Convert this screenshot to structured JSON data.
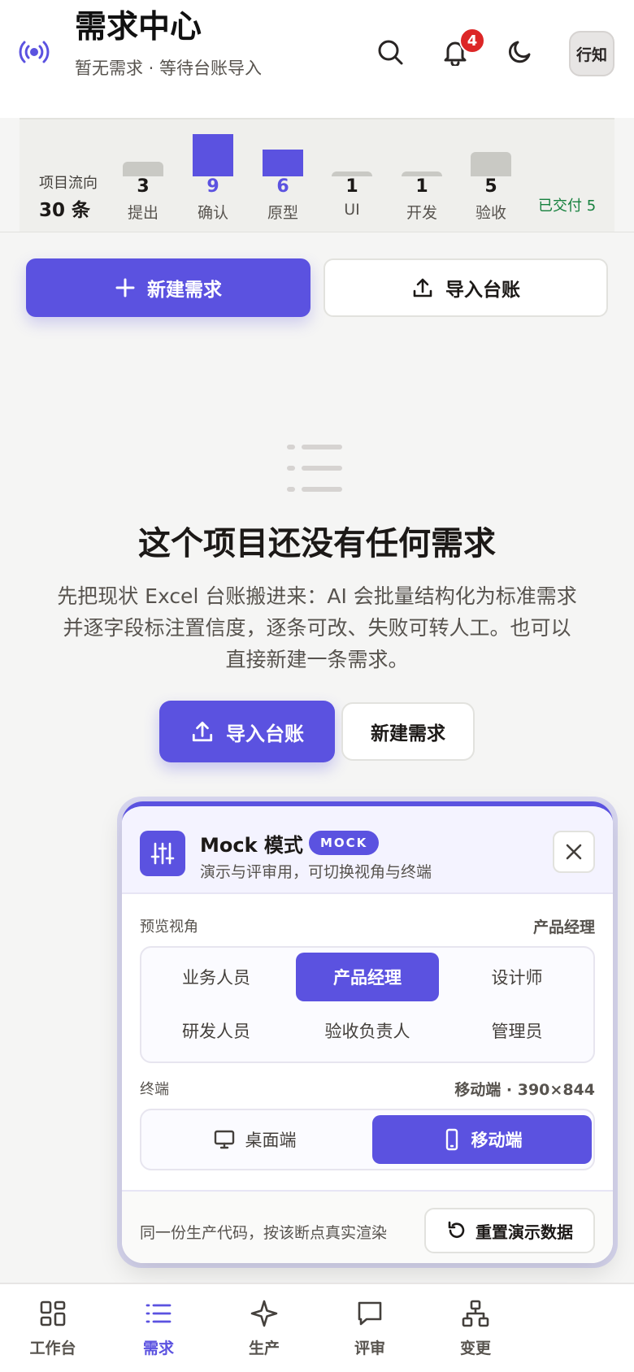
{
  "header": {
    "title": "需求中心",
    "subtitle": "暂无需求 · 等待台账导入",
    "notification_count": "4",
    "avatar_text": "行知",
    "icons": [
      "signal-icon",
      "search-icon",
      "bell-icon",
      "moon-icon"
    ]
  },
  "flow": {
    "label": "项目流向",
    "total": "30 条",
    "stages": [
      {
        "name": "提出",
        "count": "3"
      },
      {
        "name": "确认",
        "count": "9"
      },
      {
        "name": "原型",
        "count": "6"
      },
      {
        "name": "UI",
        "count": "1"
      },
      {
        "name": "开发",
        "count": "1"
      },
      {
        "name": "验收",
        "count": "5"
      }
    ],
    "delivered": "已交付 5"
  },
  "actions": {
    "new_label": "新建需求",
    "import_label": "导入台账"
  },
  "empty_state": {
    "title": "这个项目还没有任何需求",
    "description": "先把现状 Excel 台账搬进来：AI 会批量结构化为标准需求并逐字段标注置信度，逐条可改、失败可转人工。也可以直接新建一条需求。",
    "import_label": "导入台账",
    "new_label": "新建需求"
  },
  "mock_panel": {
    "title": "Mock 模式",
    "tag": "MOCK",
    "subtitle": "演示与评审用，可切换视角与终端",
    "view_label": "预览视角",
    "view_value": "产品经理",
    "roles": [
      "业务人员",
      "产品经理",
      "设计师",
      "研发人员",
      "验收负责人",
      "管理员"
    ],
    "active_role": "产品经理",
    "terminal_label": "终端",
    "terminal_value": "移动端 · 390×844",
    "terminals": [
      "桌面端",
      "移动端"
    ],
    "active_terminal": "移动端",
    "footer_text": "同一份生产代码，按该断点真实渲染",
    "reset_label": "重置演示数据"
  },
  "bottom_nav": {
    "items": [
      {
        "label": "工作台",
        "icon": "grid-icon"
      },
      {
        "label": "需求",
        "icon": "list-icon"
      },
      {
        "label": "生产",
        "icon": "sparkle-icon"
      },
      {
        "label": "评审",
        "icon": "message-icon"
      },
      {
        "label": "变更",
        "icon": "hierarchy-icon"
      }
    ],
    "active": "需求"
  },
  "colors": {
    "accent": "#5b52e0",
    "badge": "#dc2626",
    "delivered": "#15803d"
  }
}
